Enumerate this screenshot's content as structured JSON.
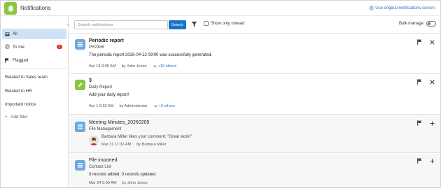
{
  "header": {
    "title": "Notifications",
    "original_link": "Use original notifications screen",
    "app_icon": "bell-icon",
    "accent": "#8cc63f"
  },
  "sidebar": {
    "items": [
      {
        "label": "All",
        "icon": "inbox-icon",
        "active": true
      },
      {
        "label": "To me",
        "icon": "at-icon",
        "badge": "1"
      },
      {
        "label": "Flagged",
        "icon": "flag-icon"
      }
    ],
    "links": [
      "Related to Sales team",
      "Related to HR",
      "Important notice"
    ],
    "add_filter": "Add filter"
  },
  "toolbar": {
    "search_placeholder": "Search notifications",
    "search_button": "Search",
    "show_unread": "Show only unread",
    "bulk_manage": "Bulk manage"
  },
  "notifications": [
    {
      "title": "Periodic report",
      "subtitle": "PR2186",
      "message": "The periodic report 2026-04-13 09:00 was successfully generated.",
      "date": "Apr 13 9:00 AM",
      "by": "by John Jones",
      "others": "+10 others",
      "icon": "list-icon",
      "icon_color": "#6fa8dc",
      "unread": true
    },
    {
      "title": "3",
      "subtitle": "Daily Report",
      "message": "Add your daily report!",
      "date": "Apr 1 9:52 AM",
      "by": "by Administrator",
      "others": "+3 others",
      "icon": "pencil-icon",
      "icon_color": "#8cc63f",
      "unread": true
    },
    {
      "title": "Meeting Minutes_20260209",
      "subtitle": "File Management",
      "message": "Barbara Miller likes your comment: \"Great work!\"",
      "date": "Mar 31 11:32 AM",
      "by": "by Barbara Miller",
      "icon": "list-icon",
      "icon_color": "#6fa8dc",
      "unread": false
    },
    {
      "title": "File imported",
      "subtitle": "Contact List",
      "message": "0 records added, 3 records updated.",
      "date": "Mar 24 9:00 AM",
      "by": "by John Jones",
      "icon": "list-icon",
      "icon_color": "#6fa8dc",
      "unread": false
    }
  ]
}
